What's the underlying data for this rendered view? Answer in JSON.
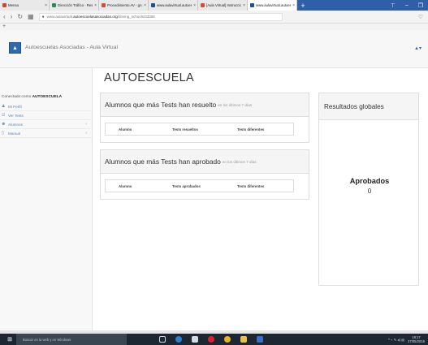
{
  "browser": {
    "tabs": [
      {
        "label": "Mensa",
        "color": "#d9412f"
      },
      {
        "label": "Dirección Tráfico - Resumen exám",
        "color": "#2e8b57"
      },
      {
        "label": "Procedimiento AV - grupo",
        "color": "#d54b3d"
      },
      {
        "label": "www.aulavirtual.autoescu",
        "color": "#1e4f8f"
      },
      {
        "label": "[Aula Virtual] Instruccion",
        "color": "#d54b3d"
      },
      {
        "label": "www.aulavirtual.autoescu",
        "color": "#1e4f8f",
        "active": true
      }
    ],
    "new_tab": "+",
    "window_controls": [
      "⊤",
      "–",
      "❐"
    ],
    "url_prefix": "www.aulavirtual.",
    "url_domain": "autoescuelasasociadas.org",
    "url_path": "/driving_schools/33358",
    "favorites_plus": "+"
  },
  "header": {
    "title": "Autoescuelas Asociadas - Aula Virtual",
    "user_menu": "▲▾"
  },
  "sidebar": {
    "connected_prefix": "Conectado como",
    "connected_user": "AUTOESCUELA",
    "items": [
      {
        "label": "Mi Perfil",
        "icon": "user-icon"
      },
      {
        "label": "Ver Tests",
        "icon": "check-list-icon"
      },
      {
        "label": "Alumnos",
        "icon": "users-icon",
        "chevron": "‹"
      },
      {
        "label": "Manual",
        "icon": "document-icon",
        "chevron": "‹"
      }
    ]
  },
  "main": {
    "page_title": "AUTOESCUELA",
    "resolved_panel": {
      "title": "Alumnos que más Tests han resuelto",
      "subtitle": "en los últimos 7 días",
      "columns": [
        "Alumno",
        "Tests resueltos",
        "Tests diferentes"
      ]
    },
    "approved_panel": {
      "title": "Alumnos que más Tests han aprobado",
      "subtitle": "en los últimos 7 días",
      "columns": [
        "Alumno",
        "Tests aprobados",
        "Tests diferentes"
      ]
    },
    "global_panel": {
      "title": "Resultados globales",
      "approved_label": "Aprobados",
      "approved_value": "0"
    }
  },
  "taskbar": {
    "search_placeholder": "Buscar en la web y en Windows",
    "time": "18:17",
    "date": "27/05/2016",
    "tray": "^ ⌁ ✎ ◂) ▤"
  }
}
